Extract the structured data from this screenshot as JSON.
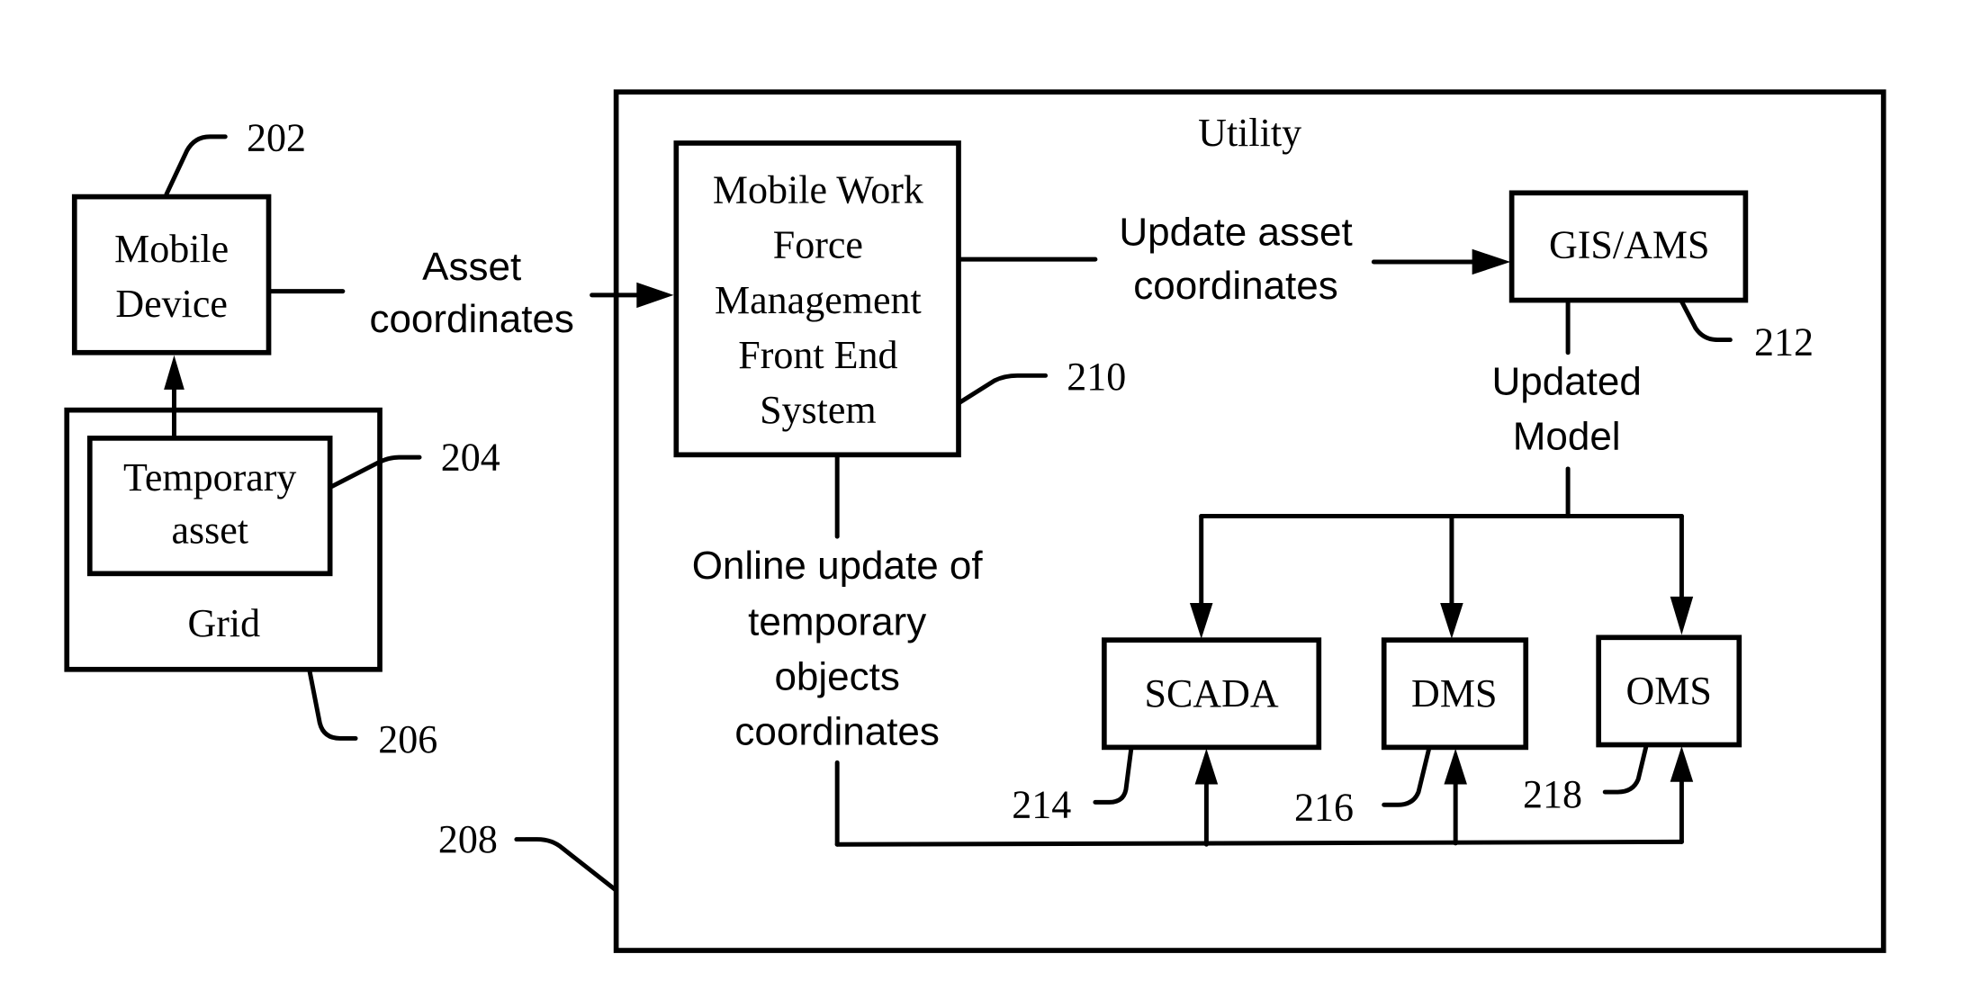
{
  "diagram": {
    "container": {
      "title": "Utility",
      "ref": "208"
    },
    "nodes": {
      "mobile_device": {
        "lines": [
          "Mobile",
          "Device"
        ],
        "ref": "202"
      },
      "temporary_asset": {
        "lines": [
          "Temporary",
          "asset"
        ],
        "ref": "204"
      },
      "grid": {
        "label": "Grid",
        "ref": "206"
      },
      "mwfm": {
        "lines": [
          "Mobile Work",
          "Force",
          "Management",
          "Front End",
          "System"
        ],
        "ref": "210"
      },
      "gis_ams": {
        "label": "GIS/AMS",
        "ref": "212"
      },
      "scada": {
        "label": "SCADA",
        "ref": "214"
      },
      "dms": {
        "label": "DMS",
        "ref": "216"
      },
      "oms": {
        "label": "OMS",
        "ref": "218"
      }
    },
    "edges": {
      "asset_coordinates": {
        "lines": [
          "Asset",
          "coordinates"
        ],
        "from": "Mobile Device",
        "to": "Mobile Work Force Management Front End System"
      },
      "update_asset_coordinates": {
        "lines": [
          "Update asset",
          "coordinates"
        ],
        "from": "Mobile Work Force Management Front End System",
        "to": "GIS/AMS"
      },
      "updated_model": {
        "lines": [
          "Updated",
          "Model"
        ],
        "from": "GIS/AMS",
        "to": [
          "SCADA",
          "DMS",
          "OMS"
        ]
      },
      "online_update": {
        "lines": [
          "Online update of",
          "temporary",
          "objects",
          "coordinates"
        ],
        "from": "Mobile Work Force Management Front End System",
        "to": [
          "SCADA",
          "DMS",
          "OMS"
        ]
      },
      "grid_to_device": {
        "from": "Temporary asset",
        "to": "Mobile Device"
      }
    }
  }
}
